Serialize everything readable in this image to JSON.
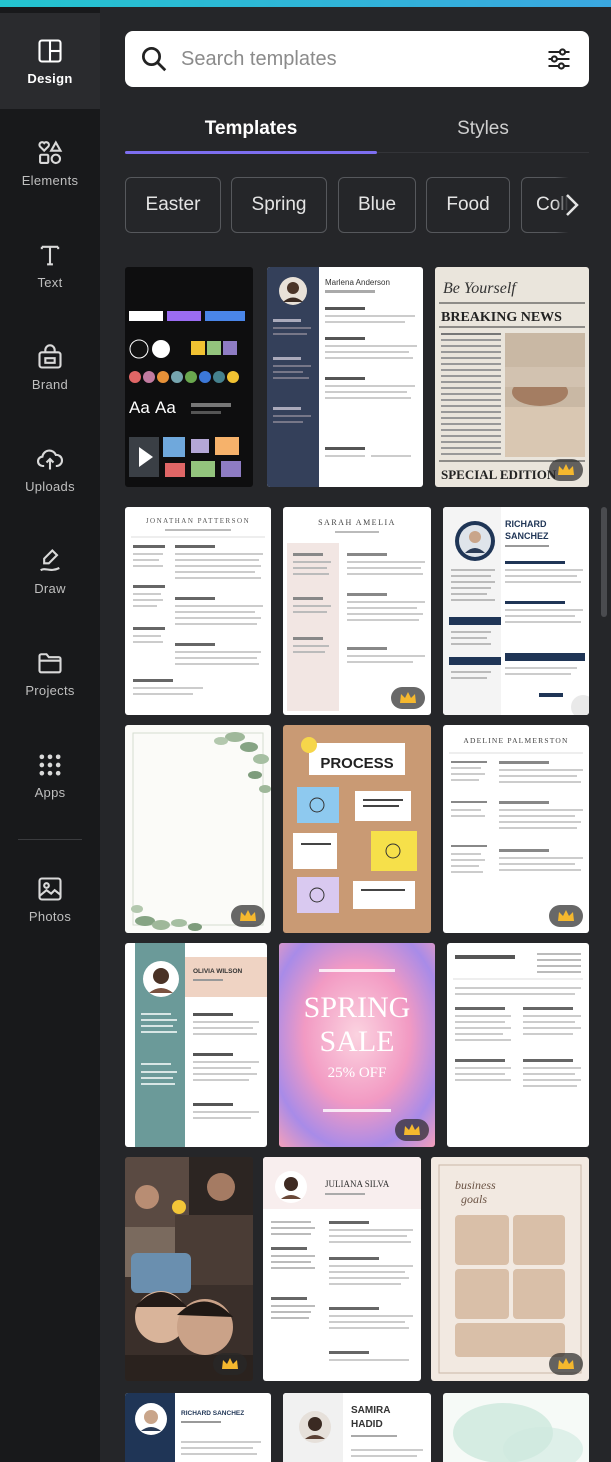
{
  "rail": {
    "items": [
      {
        "label": "Design",
        "icon": "layout-icon"
      },
      {
        "label": "Elements",
        "icon": "shapes-icon"
      },
      {
        "label": "Text",
        "icon": "text-icon"
      },
      {
        "label": "Brand",
        "icon": "brand-icon"
      },
      {
        "label": "Uploads",
        "icon": "cloud-upload-icon"
      },
      {
        "label": "Draw",
        "icon": "pen-icon"
      },
      {
        "label": "Projects",
        "icon": "folder-icon"
      },
      {
        "label": "Apps",
        "icon": "grid-dots-icon"
      },
      {
        "label": "Photos",
        "icon": "image-icon"
      }
    ]
  },
  "search": {
    "placeholder": "Search templates"
  },
  "tabs": [
    {
      "label": "Templates"
    },
    {
      "label": "Styles"
    }
  ],
  "chips": [
    "Easter",
    "Spring",
    "Blue",
    "Food",
    "Coll"
  ],
  "templates": {
    "resume_marlena": {
      "name": "Marlena Anderson"
    },
    "breaking_news": {
      "script": "Be Yourself",
      "headline": "BREAKING NEWS",
      "footer": "SPECIAL EDITION"
    },
    "resume_jonathan": {
      "name": "JONATHAN PATTERSON"
    },
    "resume_sarah": {
      "name": "SARAH AMELIA"
    },
    "resume_richard": {
      "name_line1": "RICHARD",
      "name_line2": "SANCHEZ"
    },
    "process": {
      "title": "PROCESS"
    },
    "resume_adeline": {
      "name": "ADELINE PALMERSTON"
    },
    "resume_olivia": {
      "name": "OLIVIA WILSON"
    },
    "spring_sale": {
      "line1": "SPRING",
      "line2": "SALE",
      "line3": "25% OFF"
    },
    "resume_juliana": {
      "name": "JULIANA SILVA"
    },
    "business_goals": {
      "title_line1": "business",
      "title_line2": "goals"
    },
    "resume_richard2": {
      "name": "RICHARD SANCHEZ"
    },
    "resume_samira": {
      "name_line1": "SAMIRA",
      "name_line2": "HADID"
    },
    "brand_kit": {
      "sample1": "Aa",
      "sample2": "Aa"
    }
  },
  "colors": {
    "accent": "#7d6ef0",
    "panel": "#252629",
    "rail": "#18191b",
    "crown": "#f5b82e"
  }
}
